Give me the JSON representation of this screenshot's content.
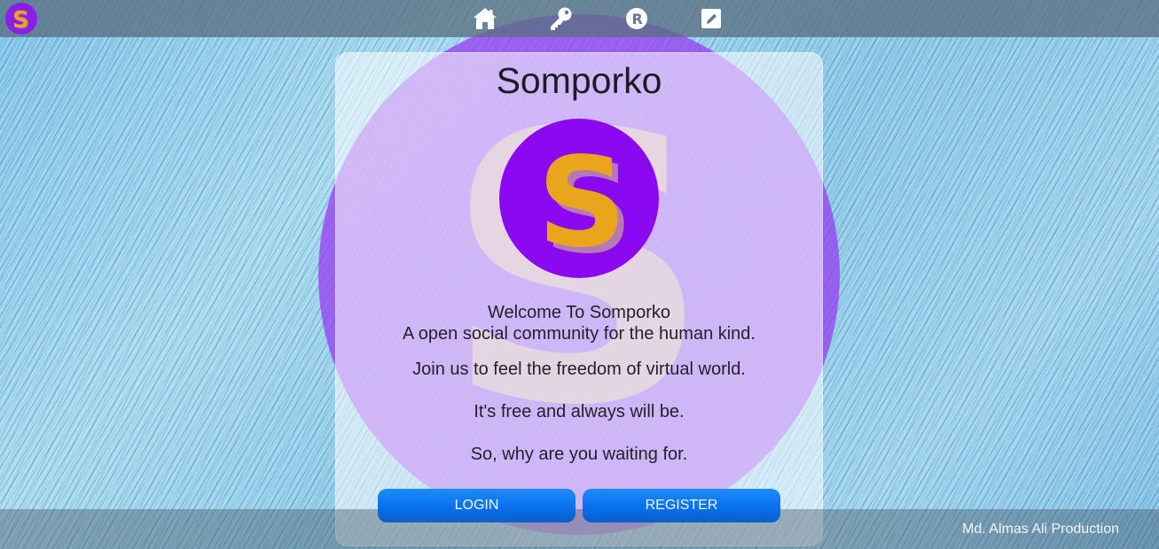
{
  "nav": {
    "logo_letter": "S",
    "icons": [
      "home-icon",
      "key-icon",
      "register-icon",
      "edit-icon"
    ],
    "register_letter": "R"
  },
  "main": {
    "title": "Somporko",
    "logo_letter": "S",
    "welcome": "Welcome To Somporko",
    "tagline": "A open social community for the human kind.",
    "join": "Join us to feel the freedom of virtual world.",
    "free": "It's free and always will be.",
    "waiting": "So, why are you waiting for.",
    "login_label": "LOGIN",
    "register_label": "REGISTER"
  },
  "footer": {
    "credit": "Md. Almas Ali Production"
  },
  "colors": {
    "brand_purple": "#8b09f0",
    "s_yellow": "#e9a51c",
    "button_blue": "#0a70ee"
  }
}
